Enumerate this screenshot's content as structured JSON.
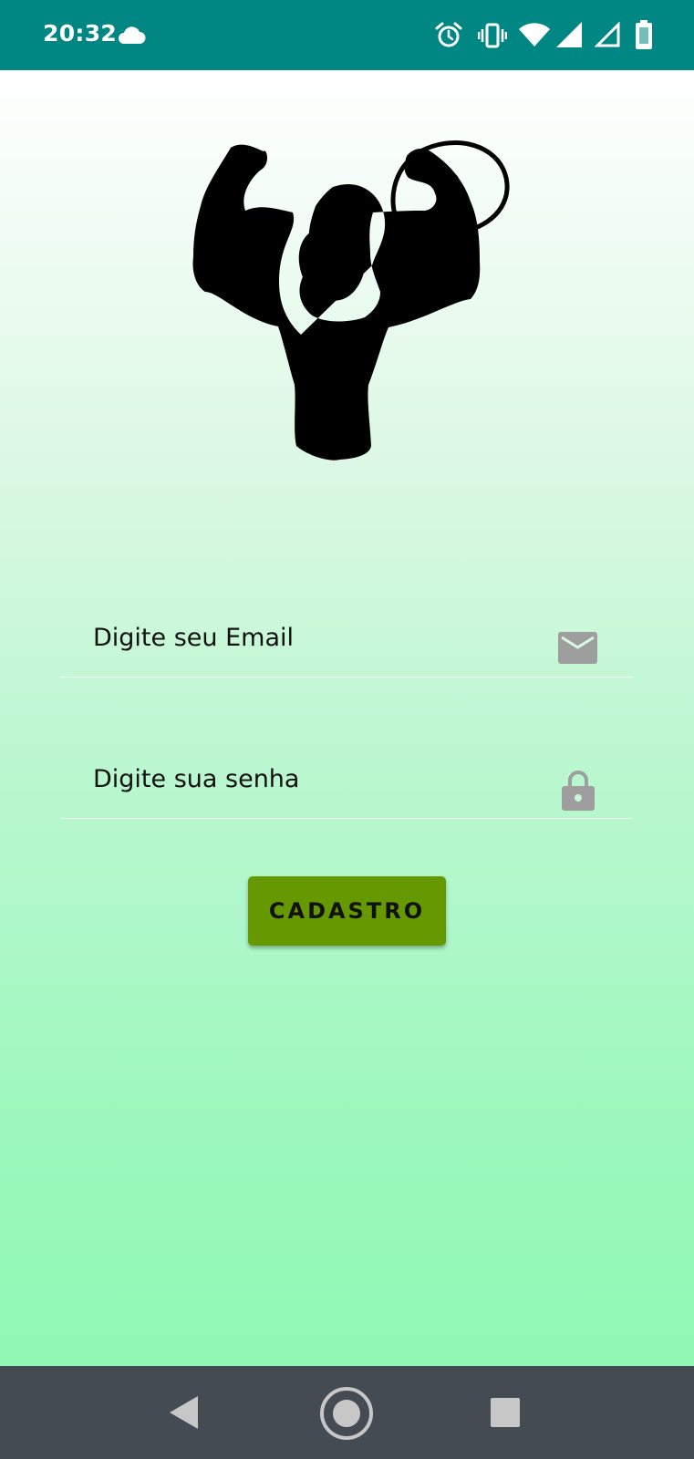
{
  "status_bar": {
    "time": "20:32",
    "icons": [
      "cloud-icon",
      "alarm-icon",
      "vibrate-icon",
      "wifi-icon",
      "signal-icon",
      "signal-icon",
      "battery-icon"
    ]
  },
  "form": {
    "email_placeholder": "Digite seu Email",
    "email_icon": "mail-icon",
    "password_placeholder": "Digite sua senha",
    "password_icon": "lock-icon",
    "submit_label": "CADASTRO"
  },
  "hero": {
    "icon": "muscle-man-question-icon"
  },
  "nav_bar": {
    "icons": [
      "back-icon",
      "home-icon",
      "recents-icon"
    ]
  },
  "colors": {
    "status_bar": "#008784",
    "button": "#669900",
    "nav_bar": "#454b52",
    "field_icon": "#9e9e9e",
    "gradient_top": "#ffffff",
    "gradient_bottom": "#8ff8b4"
  }
}
